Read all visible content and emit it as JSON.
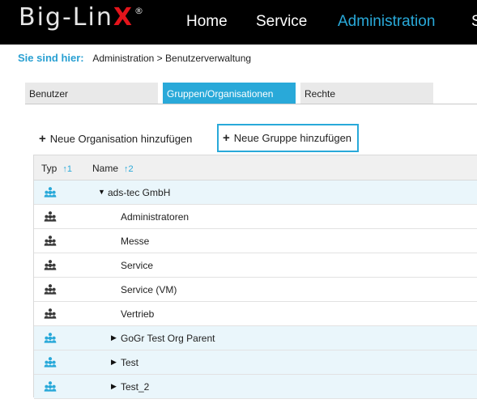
{
  "app": {
    "logo_text": "Big-Lin",
    "logo_accent": "X",
    "logo_registered": "®",
    "nav": [
      "Home",
      "Service",
      "Administration",
      "S"
    ],
    "active_nav_index": 2
  },
  "breadcrumb": {
    "label": "Sie sind hier:",
    "path": "Administration > Benutzerverwaltung"
  },
  "tabs": [
    {
      "label": "Benutzer",
      "active": false
    },
    {
      "label": "Gruppen/Organisationen",
      "active": true
    },
    {
      "label": "Rechte",
      "active": false
    }
  ],
  "actions": {
    "plus_glyph": "+",
    "add_organisation": "Neue Organisation hinzufügen",
    "add_group": "Neue Gruppe hinzufügen"
  },
  "table": {
    "columns": [
      {
        "label": "Typ",
        "sort": "↑1"
      },
      {
        "label": "Name",
        "sort": "↑2"
      }
    ],
    "rows": [
      {
        "type": "organisation",
        "name": "ads-tec GmbH",
        "toggle": "▼",
        "level": 0
      },
      {
        "type": "group",
        "name": "Administratoren",
        "toggle": "",
        "level": 1
      },
      {
        "type": "group",
        "name": "Messe",
        "toggle": "",
        "level": 1
      },
      {
        "type": "group",
        "name": "Service",
        "toggle": "",
        "level": 1
      },
      {
        "type": "group",
        "name": "Service (VM)",
        "toggle": "",
        "level": 1
      },
      {
        "type": "group",
        "name": "Vertrieb",
        "toggle": "",
        "level": 1
      },
      {
        "type": "organisation",
        "name": "GoGr Test Org Parent",
        "toggle": "▶",
        "level": 1
      },
      {
        "type": "organisation",
        "name": "Test",
        "toggle": "▶",
        "level": 1
      },
      {
        "type": "organisation",
        "name": "Test_2",
        "toggle": "▶",
        "level": 1
      }
    ]
  },
  "icons": {
    "organisation": "organisation-people-icon",
    "group": "group-people-icon"
  },
  "colors": {
    "accent": "#29a9d9",
    "logo_x": "#e3141b",
    "topbar": "#000000",
    "org_row": "#eaf6fb",
    "group_icon": "#3a3a3a"
  }
}
